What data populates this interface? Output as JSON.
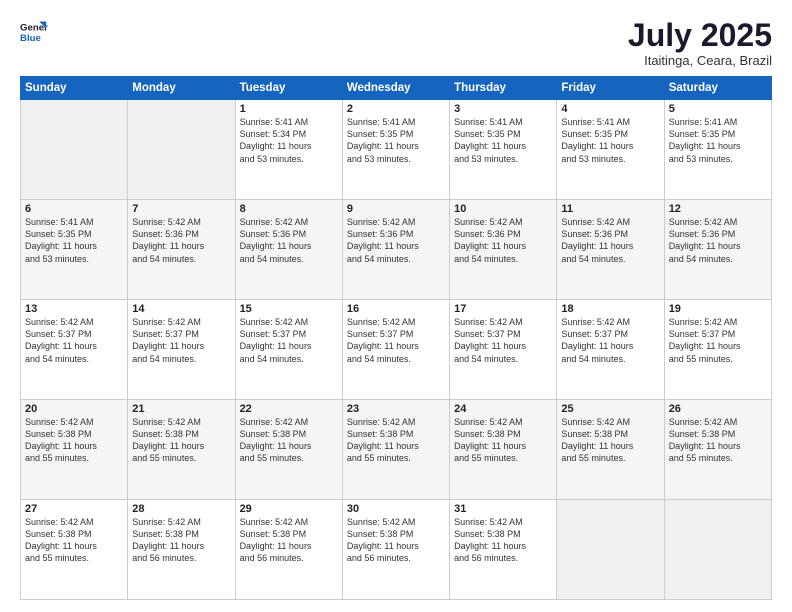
{
  "header": {
    "logo_line1": "General",
    "logo_line2": "Blue",
    "month": "July 2025",
    "location": "Itaitinga, Ceara, Brazil"
  },
  "weekdays": [
    "Sunday",
    "Monday",
    "Tuesday",
    "Wednesday",
    "Thursday",
    "Friday",
    "Saturday"
  ],
  "weeks": [
    [
      {
        "day": "",
        "info": ""
      },
      {
        "day": "",
        "info": ""
      },
      {
        "day": "1",
        "info": "Sunrise: 5:41 AM\nSunset: 5:34 PM\nDaylight: 11 hours\nand 53 minutes."
      },
      {
        "day": "2",
        "info": "Sunrise: 5:41 AM\nSunset: 5:35 PM\nDaylight: 11 hours\nand 53 minutes."
      },
      {
        "day": "3",
        "info": "Sunrise: 5:41 AM\nSunset: 5:35 PM\nDaylight: 11 hours\nand 53 minutes."
      },
      {
        "day": "4",
        "info": "Sunrise: 5:41 AM\nSunset: 5:35 PM\nDaylight: 11 hours\nand 53 minutes."
      },
      {
        "day": "5",
        "info": "Sunrise: 5:41 AM\nSunset: 5:35 PM\nDaylight: 11 hours\nand 53 minutes."
      }
    ],
    [
      {
        "day": "6",
        "info": "Sunrise: 5:41 AM\nSunset: 5:35 PM\nDaylight: 11 hours\nand 53 minutes."
      },
      {
        "day": "7",
        "info": "Sunrise: 5:42 AM\nSunset: 5:36 PM\nDaylight: 11 hours\nand 54 minutes."
      },
      {
        "day": "8",
        "info": "Sunrise: 5:42 AM\nSunset: 5:36 PM\nDaylight: 11 hours\nand 54 minutes."
      },
      {
        "day": "9",
        "info": "Sunrise: 5:42 AM\nSunset: 5:36 PM\nDaylight: 11 hours\nand 54 minutes."
      },
      {
        "day": "10",
        "info": "Sunrise: 5:42 AM\nSunset: 5:36 PM\nDaylight: 11 hours\nand 54 minutes."
      },
      {
        "day": "11",
        "info": "Sunrise: 5:42 AM\nSunset: 5:36 PM\nDaylight: 11 hours\nand 54 minutes."
      },
      {
        "day": "12",
        "info": "Sunrise: 5:42 AM\nSunset: 5:36 PM\nDaylight: 11 hours\nand 54 minutes."
      }
    ],
    [
      {
        "day": "13",
        "info": "Sunrise: 5:42 AM\nSunset: 5:37 PM\nDaylight: 11 hours\nand 54 minutes."
      },
      {
        "day": "14",
        "info": "Sunrise: 5:42 AM\nSunset: 5:37 PM\nDaylight: 11 hours\nand 54 minutes."
      },
      {
        "day": "15",
        "info": "Sunrise: 5:42 AM\nSunset: 5:37 PM\nDaylight: 11 hours\nand 54 minutes."
      },
      {
        "day": "16",
        "info": "Sunrise: 5:42 AM\nSunset: 5:37 PM\nDaylight: 11 hours\nand 54 minutes."
      },
      {
        "day": "17",
        "info": "Sunrise: 5:42 AM\nSunset: 5:37 PM\nDaylight: 11 hours\nand 54 minutes."
      },
      {
        "day": "18",
        "info": "Sunrise: 5:42 AM\nSunset: 5:37 PM\nDaylight: 11 hours\nand 54 minutes."
      },
      {
        "day": "19",
        "info": "Sunrise: 5:42 AM\nSunset: 5:37 PM\nDaylight: 11 hours\nand 55 minutes."
      }
    ],
    [
      {
        "day": "20",
        "info": "Sunrise: 5:42 AM\nSunset: 5:38 PM\nDaylight: 11 hours\nand 55 minutes."
      },
      {
        "day": "21",
        "info": "Sunrise: 5:42 AM\nSunset: 5:38 PM\nDaylight: 11 hours\nand 55 minutes."
      },
      {
        "day": "22",
        "info": "Sunrise: 5:42 AM\nSunset: 5:38 PM\nDaylight: 11 hours\nand 55 minutes."
      },
      {
        "day": "23",
        "info": "Sunrise: 5:42 AM\nSunset: 5:38 PM\nDaylight: 11 hours\nand 55 minutes."
      },
      {
        "day": "24",
        "info": "Sunrise: 5:42 AM\nSunset: 5:38 PM\nDaylight: 11 hours\nand 55 minutes."
      },
      {
        "day": "25",
        "info": "Sunrise: 5:42 AM\nSunset: 5:38 PM\nDaylight: 11 hours\nand 55 minutes."
      },
      {
        "day": "26",
        "info": "Sunrise: 5:42 AM\nSunset: 5:38 PM\nDaylight: 11 hours\nand 55 minutes."
      }
    ],
    [
      {
        "day": "27",
        "info": "Sunrise: 5:42 AM\nSunset: 5:38 PM\nDaylight: 11 hours\nand 55 minutes."
      },
      {
        "day": "28",
        "info": "Sunrise: 5:42 AM\nSunset: 5:38 PM\nDaylight: 11 hours\nand 56 minutes."
      },
      {
        "day": "29",
        "info": "Sunrise: 5:42 AM\nSunset: 5:38 PM\nDaylight: 11 hours\nand 56 minutes."
      },
      {
        "day": "30",
        "info": "Sunrise: 5:42 AM\nSunset: 5:38 PM\nDaylight: 11 hours\nand 56 minutes."
      },
      {
        "day": "31",
        "info": "Sunrise: 5:42 AM\nSunset: 5:38 PM\nDaylight: 11 hours\nand 56 minutes."
      },
      {
        "day": "",
        "info": ""
      },
      {
        "day": "",
        "info": ""
      }
    ]
  ]
}
